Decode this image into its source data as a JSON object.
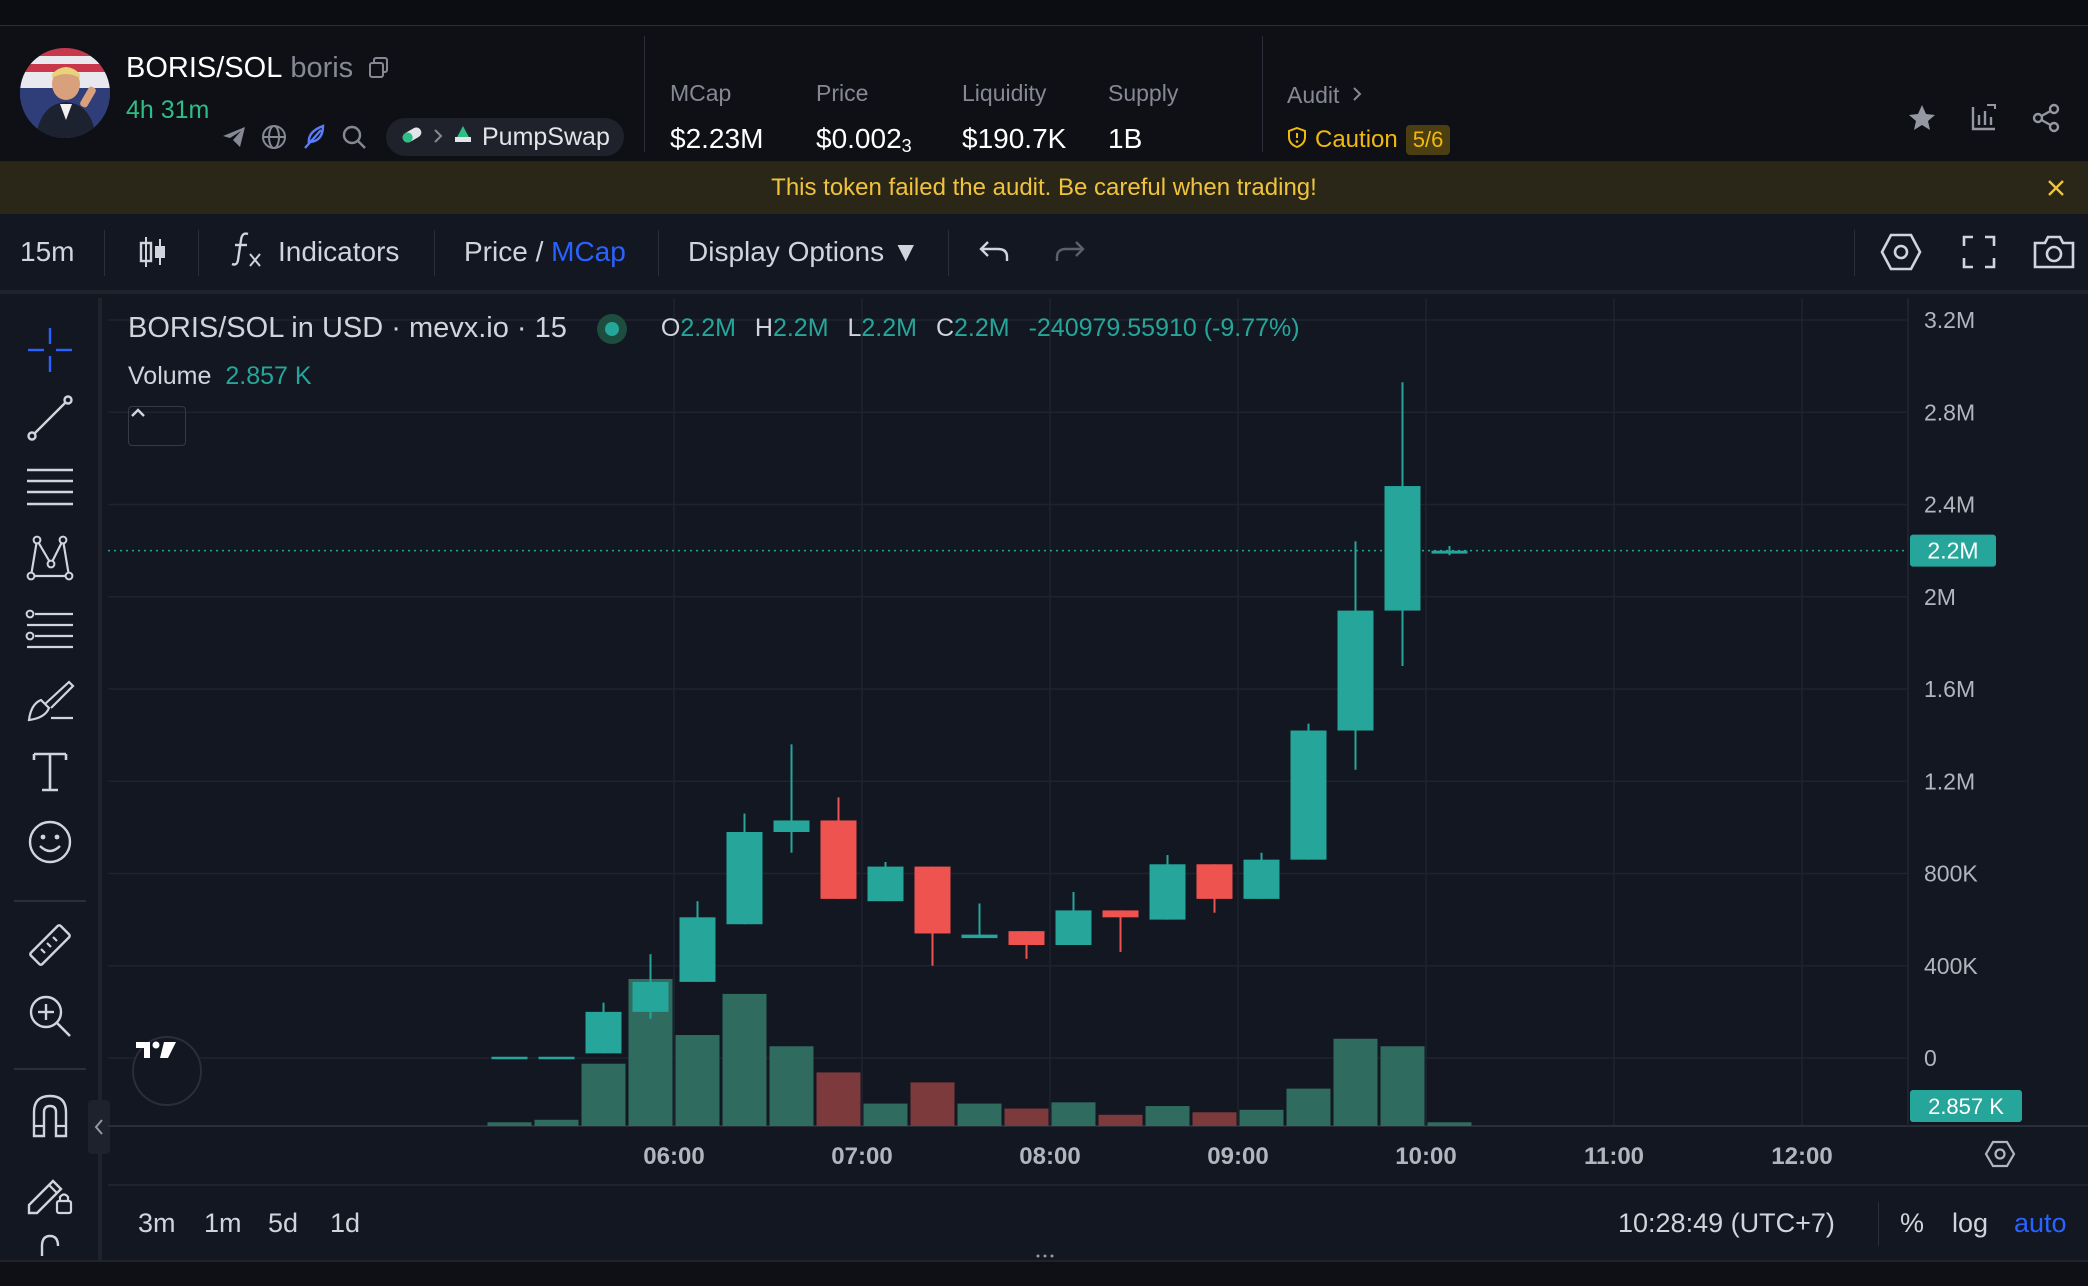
{
  "token": {
    "pair": "BORIS/SOL",
    "symbol": "boris",
    "age": "4h 31m",
    "dex": "PumpSwap"
  },
  "stats": [
    {
      "label": "MCap",
      "value": "$2.23M"
    },
    {
      "label": "Price",
      "value": "$0.002",
      "subscript": "3"
    },
    {
      "label": "Liquidity",
      "value": "$190.7K"
    },
    {
      "label": "Supply",
      "value": "1B"
    }
  ],
  "audit": {
    "label": "Audit",
    "status": "Caution",
    "score": "5/6",
    "status_color": "#f0b90b"
  },
  "banner": {
    "text": "This token failed the audit. Be careful when trading!"
  },
  "toolbar": {
    "interval": "15m",
    "indicators": "Indicators",
    "price_label": "Price",
    "slash": " / ",
    "mcap_label": "MCap",
    "display_options": "Display Options ▼"
  },
  "legend": {
    "title": "BORIS/SOL in USD · mevx.io · 15",
    "o_label": "O",
    "o": "2.2M",
    "h_label": "H",
    "h": "2.2M",
    "l_label": "L",
    "l": "2.2M",
    "c_label": "C",
    "c": "2.2M",
    "change": "-240979.55910 (-9.77%)",
    "volume_label": "Volume",
    "volume_value": "2.857 K"
  },
  "chart_data": {
    "type": "candlestick",
    "up_color": "#26a69a",
    "down_color": "#ef5350",
    "y_ticks": [
      0,
      400000,
      800000,
      1200000,
      1600000,
      2000000,
      2400000,
      2800000,
      3200000
    ],
    "y_tick_labels": [
      "0",
      "400K",
      "800K",
      "1.2M",
      "1.6M",
      "2M",
      "2.4M",
      "2.8M",
      "3.2M"
    ],
    "x_ticks": [
      "06:00",
      "07:00",
      "08:00",
      "09:00",
      "10:00",
      "11:00",
      "12:00"
    ],
    "x_tick_hours": [
      6,
      7,
      8,
      9,
      10,
      11,
      12
    ],
    "last_price_label": "2.2M",
    "last_price": 2200000,
    "last_volume_label": "2.857 K",
    "candles": [
      {
        "t": 5.125,
        "o": 0,
        "h": 0,
        "l": 0,
        "c": 0,
        "v": 3
      },
      {
        "t": 5.375,
        "o": 0,
        "h": 0,
        "l": 0,
        "c": 0,
        "v": 5
      },
      {
        "t": 5.625,
        "o": 20000,
        "h": 240000,
        "l": 20000,
        "c": 200000,
        "v": 50
      },
      {
        "t": 5.875,
        "o": 200000,
        "h": 450000,
        "l": 170000,
        "c": 330000,
        "v": 118
      },
      {
        "t": 6.125,
        "o": 330000,
        "h": 680000,
        "l": 330000,
        "c": 610000,
        "v": 73
      },
      {
        "t": 6.375,
        "o": 580000,
        "h": 1060000,
        "l": 580000,
        "c": 980000,
        "v": 106
      },
      {
        "t": 6.625,
        "o": 980000,
        "h": 1360000,
        "l": 890000,
        "c": 1030000,
        "v": 64
      },
      {
        "t": 6.875,
        "o": 1030000,
        "h": 1130000,
        "l": 690000,
        "c": 690000,
        "v": 43
      },
      {
        "t": 7.125,
        "o": 680000,
        "h": 850000,
        "l": 680000,
        "c": 830000,
        "v": 18
      },
      {
        "t": 7.375,
        "o": 830000,
        "h": 830000,
        "l": 400000,
        "c": 540000,
        "v": 35
      },
      {
        "t": 7.625,
        "o": 520000,
        "h": 670000,
        "l": 520000,
        "c": 535000,
        "v": 18
      },
      {
        "t": 7.875,
        "o": 550000,
        "h": 550000,
        "l": 430000,
        "c": 490000,
        "v": 14
      },
      {
        "t": 8.125,
        "o": 490000,
        "h": 720000,
        "l": 490000,
        "c": 640000,
        "v": 19
      },
      {
        "t": 8.375,
        "o": 640000,
        "h": 640000,
        "l": 460000,
        "c": 610000,
        "v": 9
      },
      {
        "t": 8.625,
        "o": 600000,
        "h": 880000,
        "l": 600000,
        "c": 840000,
        "v": 16
      },
      {
        "t": 8.875,
        "o": 840000,
        "h": 840000,
        "l": 630000,
        "c": 690000,
        "v": 11
      },
      {
        "t": 9.125,
        "o": 690000,
        "h": 890000,
        "l": 690000,
        "c": 860000,
        "v": 13
      },
      {
        "t": 9.375,
        "o": 860000,
        "h": 1450000,
        "l": 860000,
        "c": 1420000,
        "v": 30
      },
      {
        "t": 9.625,
        "o": 1420000,
        "h": 2240000,
        "l": 1250000,
        "c": 1940000,
        "v": 70
      },
      {
        "t": 9.875,
        "o": 1940000,
        "h": 2930000,
        "l": 1700000,
        "c": 2480000,
        "v": 64
      },
      {
        "t": 10.125,
        "o": 2200000,
        "h": 2220000,
        "l": 2180000,
        "c": 2200000,
        "v": 3
      }
    ],
    "volume_max": 130
  },
  "bottom": {
    "ranges": [
      "3m",
      "1m",
      "5d",
      "1d"
    ],
    "clock": "10:28:49 (UTC+7)",
    "percent": "%",
    "log": "log",
    "auto": "auto"
  }
}
